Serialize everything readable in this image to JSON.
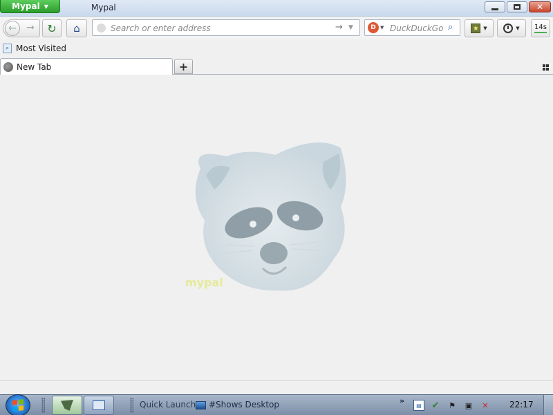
{
  "window": {
    "app_button_label": "Mypal",
    "title": "Mypal"
  },
  "navbar": {
    "url_placeholder": "Search or enter address",
    "search_placeholder": "DuckDuckGo",
    "timer_label": "14s"
  },
  "bookmarks": {
    "items": [
      {
        "label": "Most Visited",
        "icon": "most-visited-icon"
      }
    ]
  },
  "tabs": [
    {
      "label": "New Tab",
      "active": true
    }
  ],
  "content": {
    "watermark_text": "mypal"
  },
  "taskbar": {
    "quick_launch_label": "Quick Launch",
    "show_desktop_label": "#Shows Desktop",
    "clock": "22:17"
  },
  "colors": {
    "app_button": "#2c9e2c",
    "titlebar": "#c9d9ec",
    "taskbar": "#8d9fb6",
    "content_bg": "#f0f0f0"
  }
}
